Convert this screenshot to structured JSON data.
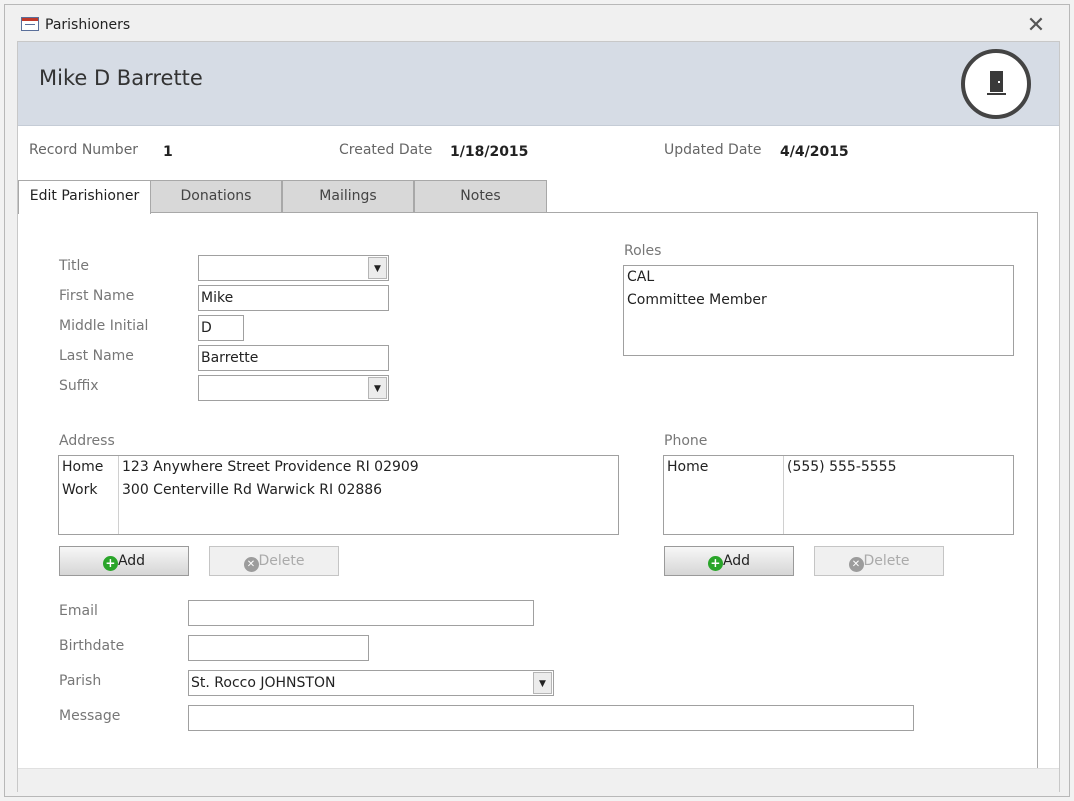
{
  "window": {
    "title": "Parishioners"
  },
  "header": {
    "name": "Mike D Barrette"
  },
  "info": {
    "record_number_label": "Record Number",
    "record_number": "1",
    "created_label": "Created Date",
    "created_value": "1/18/2015",
    "updated_label": "Updated Date",
    "updated_value": "4/4/2015"
  },
  "tabs": [
    {
      "label": "Edit Parishioner"
    },
    {
      "label": "Donations"
    },
    {
      "label": "Mailings"
    },
    {
      "label": "Notes"
    }
  ],
  "form": {
    "title_label": "Title",
    "title_value": "",
    "first_name_label": "First Name",
    "first_name_value": "Mike",
    "middle_initial_label": "Middle Initial",
    "middle_initial_value": "D",
    "last_name_label": "Last Name",
    "last_name_value": "Barrette",
    "suffix_label": "Suffix",
    "suffix_value": "",
    "email_label": "Email",
    "email_value": "",
    "birthdate_label": "Birthdate",
    "birthdate_value": "",
    "parish_label": "Parish",
    "parish_value": "St. Rocco JOHNSTON",
    "message_label": "Message",
    "message_value": ""
  },
  "roles": {
    "label": "Roles",
    "items": [
      "CAL",
      "Committee Member"
    ]
  },
  "address": {
    "label": "Address",
    "rows": [
      {
        "type": "Home",
        "value": "123 Anywhere Street Providence RI 02909"
      },
      {
        "type": "Work",
        "value": "300 Centerville Rd Warwick RI 02886"
      }
    ],
    "add_label": "Add",
    "delete_label": "Delete"
  },
  "phone": {
    "label": "Phone",
    "rows": [
      {
        "type": "Home",
        "value": "(555) 555-5555"
      }
    ],
    "add_label": "Add",
    "delete_label": "Delete"
  },
  "icons": {
    "app": "form-icon",
    "close": "close-icon",
    "exit": "exit-door-icon",
    "add": "plus-circle-icon",
    "delete": "x-circle-icon",
    "dropdown": "chevron-down-icon"
  },
  "colors": {
    "header_band": "#d6dce5",
    "add_icon": "#2aa52a",
    "label_text": "#777777"
  }
}
